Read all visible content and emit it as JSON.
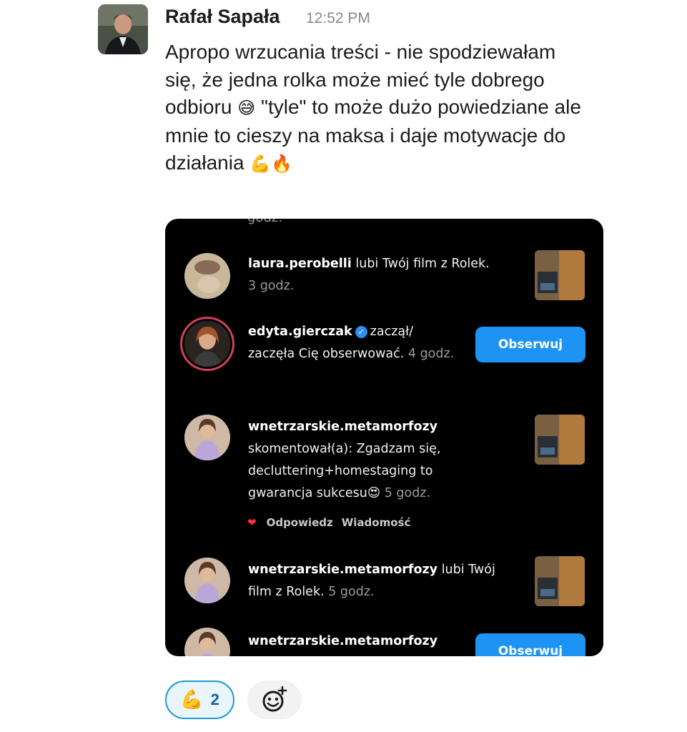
{
  "message": {
    "sender": "Rafał Sapała",
    "time": "12:52 PM",
    "text_main": "Apropo wrzucania treści - nie spodziewałam się, że jedna rolka może mieć tyle dobrego odbioru",
    "emoji_1": "😅",
    "text_mid": " \"tyle\" to może dużo powiedziane ale mnie to cieszy na maksa i daje motywacje do działania",
    "emoji_2": "💪🔥"
  },
  "instagram": {
    "cut_text": "godz.",
    "rows": [
      {
        "user": "laura.perobelli",
        "action": " lubi Twój film z Rolek.",
        "time": "3 godz."
      },
      {
        "user": "edyta.gierczak",
        "action": "zaczął/ zaczęła Cię obserwować.",
        "time": "4 godz.",
        "button": "Obserwuj"
      },
      {
        "user": "wnetrzarskie.metamorfozy",
        "action": "skomentował(a): Zgadzam się, decluttering+homestaging to gwarancja sukcesu😍",
        "time": "5 godz.",
        "reply": "Odpowiedz",
        "message": "Wiadomość"
      },
      {
        "user": "wnetrzarskie.metamorfozy",
        "action": " lubi Twój film z Rolek.",
        "time": "5 godz."
      },
      {
        "user": "wnetrzarskie.metamorfozy",
        "button": "Obserwuj"
      }
    ]
  },
  "reactions": [
    {
      "emoji": "💪",
      "count": "2"
    }
  ],
  "icons": [
    "add-reaction-icon",
    "verified-badge-icon",
    "heart-icon"
  ],
  "colors": {
    "accent": "#1d9bd1",
    "follow_button": "#1d93f3",
    "heart": "#ff3040"
  }
}
